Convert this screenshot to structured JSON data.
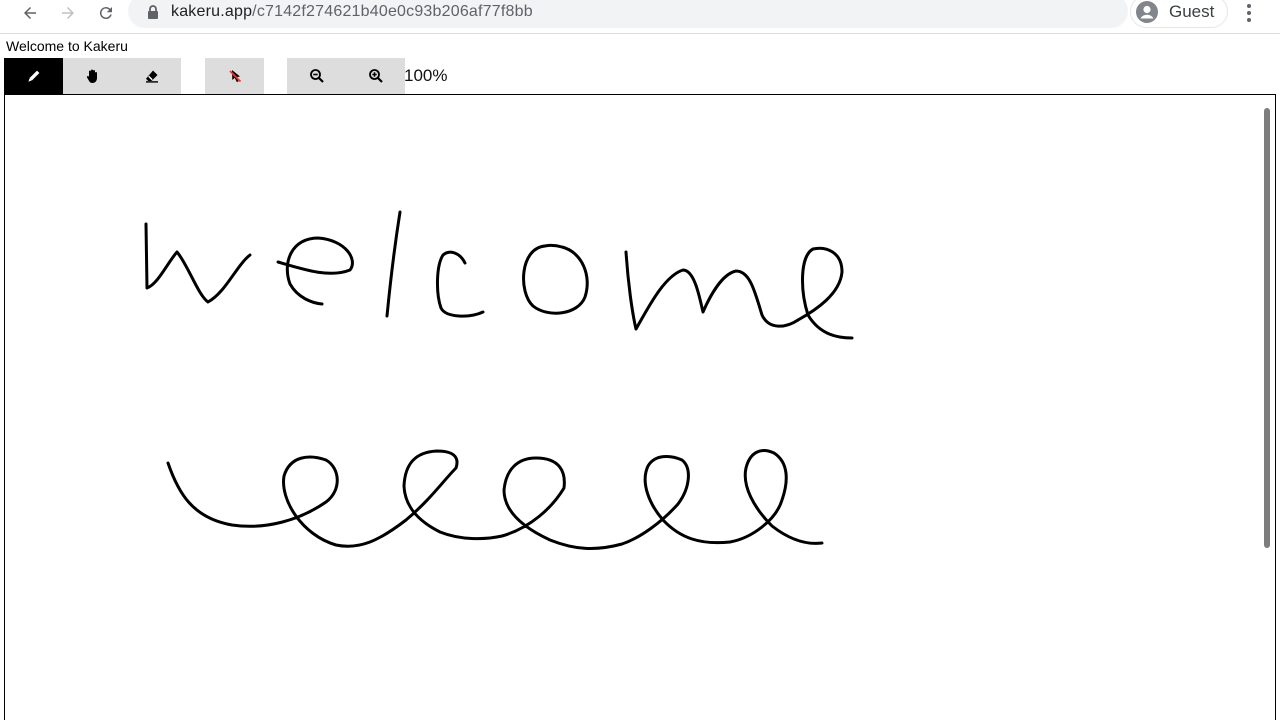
{
  "browser": {
    "url_host": "kakeru.app",
    "url_path": "/c7142f274621b40e0c93b206af77f8bb",
    "profile_label": "Guest"
  },
  "page": {
    "title": "Welcome to Kakeru"
  },
  "toolbar": {
    "tools": [
      {
        "name": "pen",
        "icon": "pencil-icon",
        "active": true
      },
      {
        "name": "hand",
        "icon": "hand-icon",
        "active": false
      },
      {
        "name": "eraser",
        "icon": "eraser-icon",
        "active": false
      },
      {
        "name": "pointer-off",
        "icon": "pointer-off-icon",
        "active": false
      },
      {
        "name": "zoom-out",
        "icon": "zoom-out-icon",
        "active": false
      },
      {
        "name": "zoom-in",
        "icon": "zoom-in-icon",
        "active": false
      }
    ],
    "zoom_level": "100%"
  },
  "colors": {
    "active_tool": "#000000",
    "tool_bg": "#dddddd",
    "pointer_off_accent": "#e53935",
    "stroke": "#000000"
  }
}
